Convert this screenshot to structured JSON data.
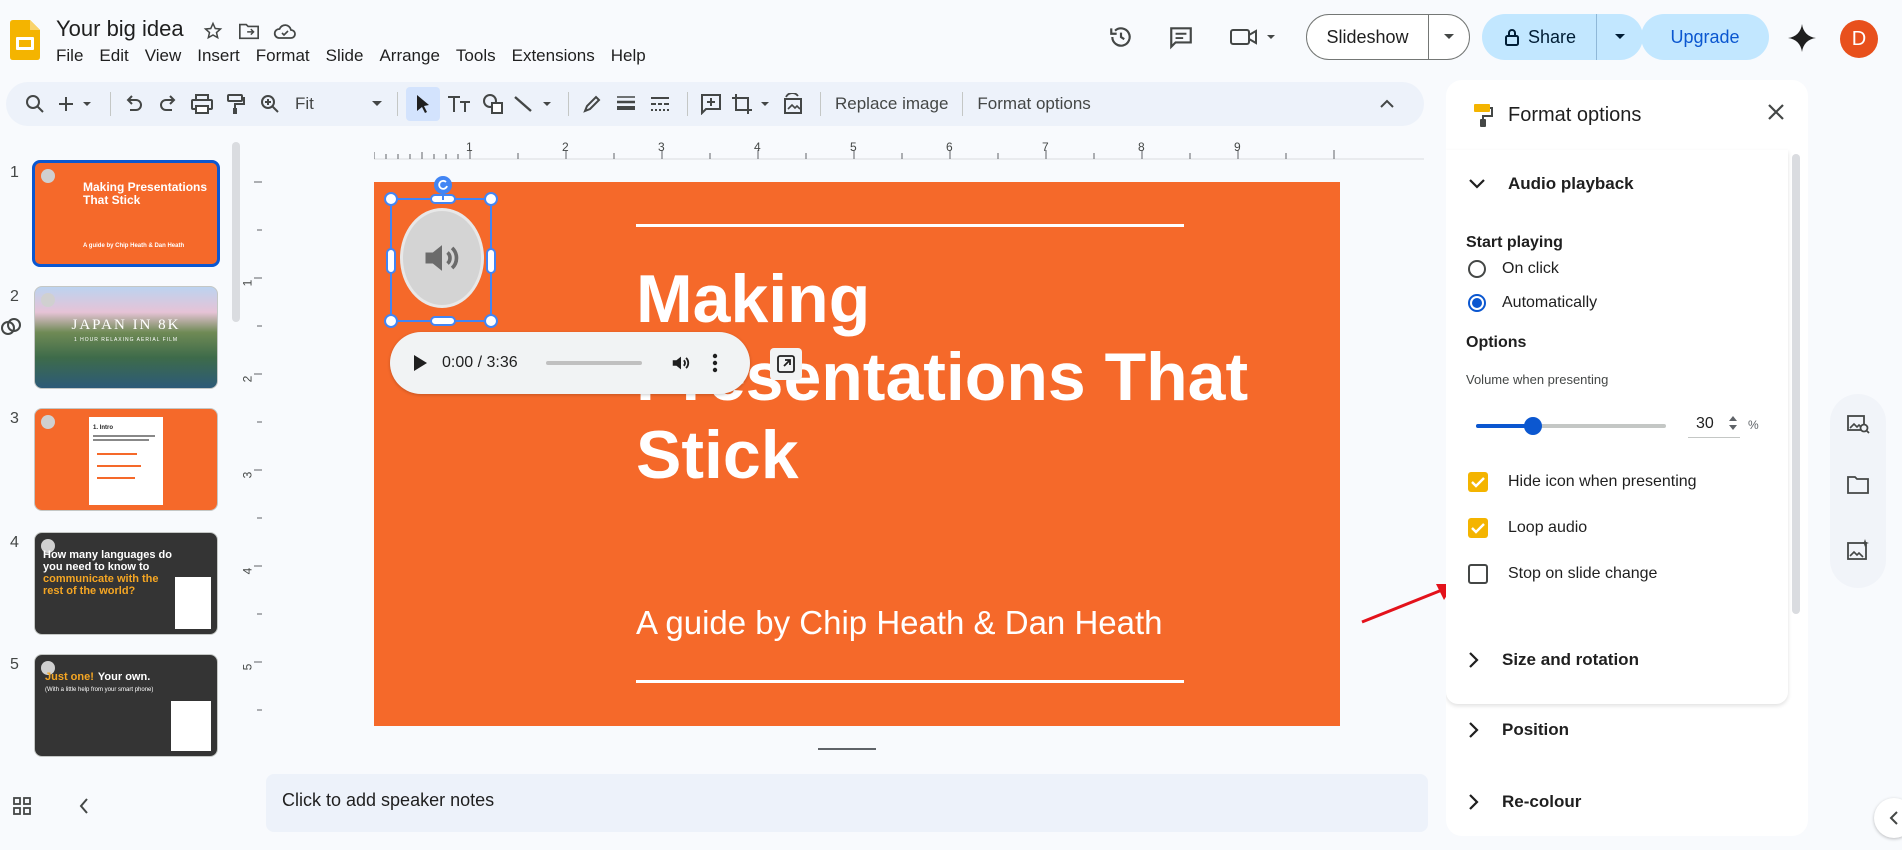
{
  "app": {
    "doc_title": "Your big idea",
    "menu": [
      "File",
      "Edit",
      "View",
      "Insert",
      "Format",
      "Slide",
      "Arrange",
      "Tools",
      "Extensions",
      "Help"
    ],
    "slideshow_label": "Slideshow",
    "share_label": "Share",
    "upgrade_label": "Upgrade",
    "avatar_initial": "D"
  },
  "toolbar": {
    "zoom": "Fit",
    "replace_image": "Replace image",
    "format_options": "Format options"
  },
  "rulers": {
    "h_ticks": [
      "1",
      "2",
      "3",
      "4",
      "5",
      "6",
      "7",
      "8",
      "9"
    ],
    "v_ticks": [
      "1",
      "2",
      "3",
      "4",
      "5"
    ]
  },
  "slides": [
    {
      "num": "1",
      "title": "Making Presentations That Stick",
      "sub": "A guide by Chip Heath & Dan Heath"
    },
    {
      "num": "2",
      "title": "JAPAN IN 8K",
      "sub": "1 HOUR RELAXING AERIAL FILM"
    },
    {
      "num": "3",
      "title": "1. Intro"
    },
    {
      "num": "4",
      "title_a": "How many languages do you need to know to",
      "title_b": "communicate with the rest of the world?"
    },
    {
      "num": "5",
      "title_a": "Just one!",
      "title_b": "Your own.",
      "sub": "(With a little help from your smart phone)"
    }
  ],
  "slide": {
    "title": "Making Presentations That Stick",
    "subtitle": "A guide by Chip Heath & Dan Heath"
  },
  "player": {
    "time": "0:00 / 3:36"
  },
  "notes": {
    "placeholder": "Click to add speaker notes"
  },
  "panel": {
    "title": "Format options",
    "audio_playback": "Audio playback",
    "start_playing": "Start playing",
    "on_click": "On click",
    "automatically": "Automatically",
    "options": "Options",
    "volume_label": "Volume when presenting",
    "volume_value": "30",
    "volume_unit": "%",
    "volume_level": 0.3,
    "hide_icon": "Hide icon when presenting",
    "loop_audio": "Loop audio",
    "stop_on_change": "Stop on slide change",
    "size_rotation": "Size and rotation",
    "position": "Position",
    "recolour": "Re-colour"
  },
  "colors": {
    "accent": "#0b57d0",
    "slide_bg": "#f5692a",
    "checkbox": "#f4b400"
  }
}
